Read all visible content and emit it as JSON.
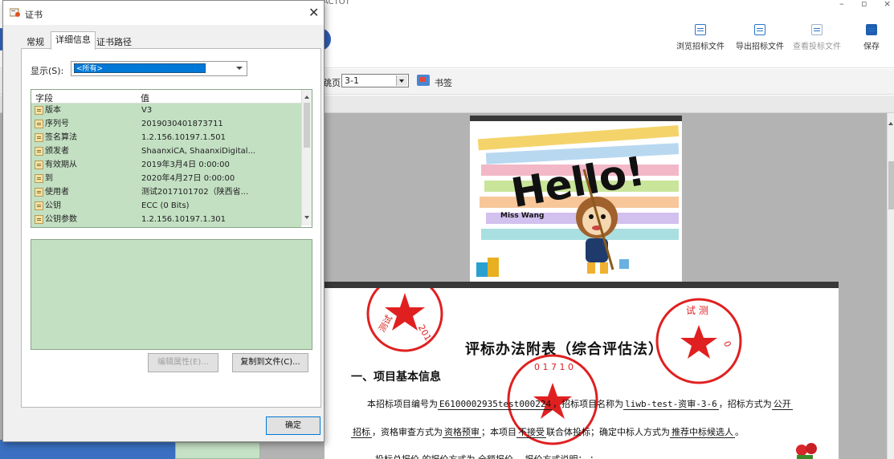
{
  "app": {
    "title_fragment": "ACTOT",
    "toolbar": [
      {
        "label": "浏览招标文件",
        "icon": "browse-doc-icon",
        "enabled": true
      },
      {
        "label": "导出招标文件",
        "icon": "export-doc-icon",
        "enabled": true
      },
      {
        "label": "查看投标文件",
        "icon": "view-bid-icon",
        "enabled": false
      },
      {
        "label": "保存",
        "icon": "save-icon",
        "enabled": true
      }
    ],
    "nav": {
      "label": "跳页",
      "page_value": "3-1",
      "bookmark_label": "书签"
    }
  },
  "document": {
    "page1": {
      "image_text": "Hello!",
      "caption": "Miss Wang"
    },
    "page2": {
      "title": "评标办法附表（综合评估法）",
      "section": "一、项目基本信息",
      "p1_pre": "本招标项目编号为",
      "project_no": "E6100002935test000224",
      "p1_mid": "，招标项目名称为",
      "project_name": "liwb-test-资审-3-6",
      "p1_mid2": "，招标方式为",
      "method_a": "公开",
      "method_b": "招标",
      "p2_a": "，资格审查方式为",
      "review": "资格预审",
      "p2_b": "；本项目",
      "consortium": "不接受",
      "p2_c": "联合体投标；确定中标人方式为",
      "winner": "推荐中标候选人",
      "p2_d": "。",
      "p3": "投标总报价 的报价方式为 全额报价 ，报价方式说明：   ；"
    },
    "seals": [
      {
        "text": "测试201702",
        "color": "#e02020"
      },
      {
        "text": "测试测试01",
        "color": "#e02020"
      },
      {
        "text": "01710170",
        "color": "#e02020"
      }
    ]
  },
  "dialog": {
    "title": "证书",
    "close_glyph": "✕",
    "tabs": [
      {
        "label": "常规",
        "active": false
      },
      {
        "label": "详细信息",
        "active": true
      },
      {
        "label": "证书路径",
        "active": false
      }
    ],
    "show": {
      "label": "显示(S):",
      "value": "<所有>"
    },
    "columns": {
      "field": "字段",
      "value": "值"
    },
    "rows": [
      {
        "field": "版本",
        "value": "V3"
      },
      {
        "field": "序列号",
        "value": "2019030401873711"
      },
      {
        "field": "签名算法",
        "value": "1.2.156.10197.1.501"
      },
      {
        "field": "颁发者",
        "value": "ShaanxiCA, ShaanxiDigital..."
      },
      {
        "field": "有效期从",
        "value": "2019年3月4日 0:00:00"
      },
      {
        "field": "到",
        "value": "2020年4月27日 0:00:00"
      },
      {
        "field": "使用者",
        "value": "测试2017101702（陕西省..."
      },
      {
        "field": "公钥",
        "value": "ECC (0 Bits)"
      },
      {
        "field": "公钥参数",
        "value": "1.2.156.10197.1.301"
      }
    ],
    "buttons": {
      "edit": "编辑属性(E)...",
      "copy": "复制到文件(C)...",
      "ok": "确定"
    }
  }
}
